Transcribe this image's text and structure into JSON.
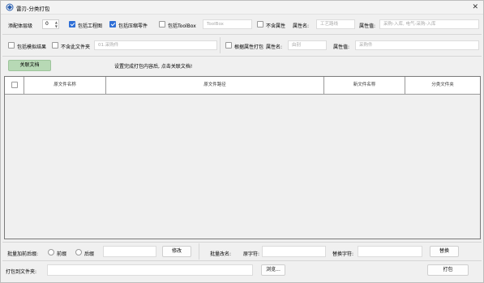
{
  "window": {
    "title": "雷刃-分类打包",
    "close_glyph": "✕"
  },
  "options": {
    "add_body_level_label": "添配体层级",
    "body_level_value": "0",
    "include_drawing_label": "包括工程图",
    "include_drawing_checked": true,
    "include_compressed_label": "包括压缩零件",
    "include_compressed_checked": true,
    "include_toolbox_label": "包括ToolBox",
    "include_toolbox_checked": false,
    "toolbox_placeholder": "ToolBox",
    "exclude_attr_label": "不含属性",
    "exclude_attr_checked": false,
    "attr_name_label": "属性名:",
    "attr_name_placeholder": "工艺路线",
    "attr_value_label": "属性值:",
    "attr_value_placeholder": "采购-入库, 电气-采购-入库",
    "include_sim_label": "包括模拟结果",
    "include_sim_checked": false,
    "exclude_subfolder_label": "不含此文件夹",
    "exclude_subfolder_checked": false,
    "subfolder_placeholder": "01.采购件",
    "pack_by_attr_label": "根据属性打包",
    "pack_by_attr_checked": false,
    "pack_attr_name_label": "属性名:",
    "pack_attr_name_placeholder": "由别",
    "pack_attr_value_label": "属性值:",
    "pack_attr_value_placeholder": "采购件"
  },
  "link_bar": {
    "link_button": "关联文档",
    "hint": "设置完成打包内容后, 点击关联文档!"
  },
  "table": {
    "columns": [
      "原文件名称",
      "原文件路径",
      "新文件名称",
      "分类文件夹"
    ]
  },
  "batch": {
    "prefix_suffix_label": "批量加前后缀:",
    "prefix_label": "前缀",
    "suffix_label": "后缀",
    "modify_button": "修改",
    "rename_label": "批量改名:",
    "original_char_label": "原字符:",
    "replace_char_label": "替换字符:",
    "replace_button": "替换"
  },
  "footer": {
    "pack_to_folder_label": "打包到文件夹:",
    "browse_button": "浏览...",
    "pack_button": "打包"
  },
  "colors": {
    "accent_check": "#2f6fd6",
    "link_button_bg": "#b7d9b5"
  }
}
